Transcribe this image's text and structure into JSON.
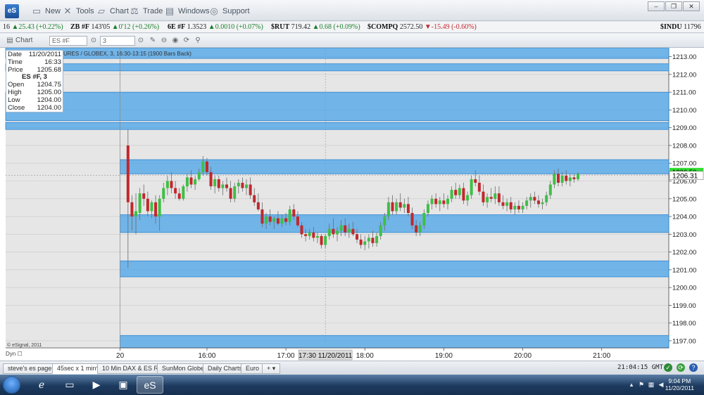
{
  "app": {
    "logo": "eS",
    "menu": [
      {
        "label": "New",
        "icon": "document-icon"
      },
      {
        "label": "Tools",
        "icon": "tools-icon"
      },
      {
        "label": "Chart",
        "icon": "chart-icon"
      },
      {
        "label": "Trade",
        "icon": "trade-icon"
      },
      {
        "label": "Windows",
        "icon": "windows-icon"
      },
      {
        "label": "Support",
        "icon": "support-icon"
      }
    ]
  },
  "ticker": [
    {
      "symbol": "16",
      "last": "",
      "change": "25.43 (+0.22%)",
      "dir": "up"
    },
    {
      "symbol": "ZB #F",
      "last": "143'05",
      "change": "0'12 (+0.26%)",
      "dir": "up"
    },
    {
      "symbol": "6E #F",
      "last": "1.3523",
      "change": "0.0010 (+0.07%)",
      "dir": "up"
    },
    {
      "symbol": "$RUT",
      "last": "719.42",
      "change": "0.68 (+0.09%)",
      "dir": "up"
    },
    {
      "symbol": "$COMPQ",
      "last": "2572.50",
      "change": "-15.49 (-0.60%)",
      "dir": "down"
    },
    {
      "symbol": "$INDU",
      "last": "11796",
      "change": "",
      "dir": "up"
    }
  ],
  "chart_window": {
    "title": "Chart",
    "symbol_value": "ES #F",
    "interval_value": "3",
    "info": "URES / GLOBEX, 3, 16:30-13:15 (1900 Bars Back)",
    "copyright": "© eSignal, 2011",
    "dyn_label": "Dyn"
  },
  "data_window": {
    "date_label": "Date",
    "date": "11/20/2011",
    "time_label": "Time",
    "time": "16:33",
    "price_label": "Price",
    "price": "1205.68",
    "header": "ES #F, 3",
    "open_label": "Open",
    "open": "1204.75",
    "high_label": "High",
    "high": "1205.00",
    "low_label": "Low",
    "low": "1204.00",
    "close_label": "Close",
    "close": "1204.00"
  },
  "chart_data": {
    "type": "candlestick",
    "title": "",
    "y_ticks": [
      1197,
      1198,
      1199,
      1200,
      1201,
      1202,
      1203,
      1204,
      1205,
      1206,
      1207,
      1208,
      1209,
      1210,
      1211,
      1212,
      1213
    ],
    "y_tick_labels": [
      "1197.00",
      "1198.00",
      "1199.00",
      "1200.00",
      "1201.00",
      "1202.00",
      "1203.00",
      "1204.00",
      "1205.00",
      "1206.00",
      "1207.00",
      "1208.00",
      "1209.00",
      "1210.00",
      "1211.00",
      "1212.00",
      "1213.00"
    ],
    "ylim": [
      1196.6,
      1213.5
    ],
    "x_labels": [
      "20",
      "16:00",
      "17:00",
      "18:00",
      "19:00",
      "20:00",
      "21:00"
    ],
    "x_label_times": [
      14.9,
      16.0,
      17.0,
      18.0,
      19.0,
      20.0,
      21.0
    ],
    "xlim": [
      13.45,
      21.85
    ],
    "crosshair_time_label": "17:30 11/20/2011",
    "crosshair_time": 17.5,
    "crosshair_price": 1206.31,
    "price_label": "1206.31",
    "last_price_label": "1206.50",
    "last_price": 1206.5,
    "zones": [
      {
        "low": 1212.9,
        "high": 1213.5,
        "from": 13.45
      },
      {
        "low": 1212.2,
        "high": 1212.6,
        "from": 13.45
      },
      {
        "low": 1209.4,
        "high": 1211.0,
        "from": 13.45
      },
      {
        "low": 1208.9,
        "high": 1209.3,
        "from": 13.45
      },
      {
        "low": 1206.4,
        "high": 1207.2,
        "from": 14.9
      },
      {
        "low": 1203.1,
        "high": 1204.1,
        "from": 14.9
      },
      {
        "low": 1200.6,
        "high": 1201.5,
        "from": 14.9
      },
      {
        "low": 1196.6,
        "high": 1197.3,
        "from": 14.9
      }
    ],
    "candles": [
      {
        "t": 15.0,
        "o": 1208.0,
        "h": 1208.9,
        "l": 1201.1,
        "c": 1204.8
      },
      {
        "t": 15.05,
        "o": 1204.8,
        "h": 1205.2,
        "l": 1203.2,
        "c": 1204.0
      },
      {
        "t": 15.1,
        "o": 1204.0,
        "h": 1205.3,
        "l": 1203.0,
        "c": 1204.3
      },
      {
        "t": 15.15,
        "o": 1204.2,
        "h": 1205.6,
        "l": 1203.8,
        "c": 1205.3
      },
      {
        "t": 15.2,
        "o": 1205.3,
        "h": 1205.8,
        "l": 1204.6,
        "c": 1205.0
      },
      {
        "t": 15.25,
        "o": 1205.0,
        "h": 1205.4,
        "l": 1204.0,
        "c": 1204.3
      },
      {
        "t": 15.3,
        "o": 1204.3,
        "h": 1204.9,
        "l": 1203.9,
        "c": 1204.8
      },
      {
        "t": 15.35,
        "o": 1204.8,
        "h": 1205.2,
        "l": 1203.6,
        "c": 1204.0
      },
      {
        "t": 15.4,
        "o": 1204.0,
        "h": 1205.2,
        "l": 1203.2,
        "c": 1205.0
      },
      {
        "t": 15.45,
        "o": 1205.0,
        "h": 1205.9,
        "l": 1204.8,
        "c": 1205.6
      },
      {
        "t": 15.5,
        "o": 1205.6,
        "h": 1206.3,
        "l": 1205.2,
        "c": 1206.0
      },
      {
        "t": 15.55,
        "o": 1206.0,
        "h": 1206.5,
        "l": 1205.3,
        "c": 1205.6
      },
      {
        "t": 15.6,
        "o": 1205.6,
        "h": 1206.0,
        "l": 1205.0,
        "c": 1205.3
      },
      {
        "t": 15.65,
        "o": 1205.3,
        "h": 1205.6,
        "l": 1204.9,
        "c": 1205.0
      },
      {
        "t": 15.7,
        "o": 1205.0,
        "h": 1205.8,
        "l": 1204.9,
        "c": 1205.7
      },
      {
        "t": 15.75,
        "o": 1205.7,
        "h": 1206.4,
        "l": 1205.4,
        "c": 1206.2
      },
      {
        "t": 15.8,
        "o": 1206.2,
        "h": 1206.6,
        "l": 1205.6,
        "c": 1205.8
      },
      {
        "t": 15.85,
        "o": 1205.8,
        "h": 1206.3,
        "l": 1205.5,
        "c": 1206.1
      },
      {
        "t": 15.9,
        "o": 1206.1,
        "h": 1206.7,
        "l": 1206.0,
        "c": 1206.5
      },
      {
        "t": 15.95,
        "o": 1206.5,
        "h": 1207.4,
        "l": 1206.3,
        "c": 1207.1
      },
      {
        "t": 16.0,
        "o": 1207.1,
        "h": 1207.3,
        "l": 1206.3,
        "c": 1206.5
      },
      {
        "t": 16.05,
        "o": 1206.5,
        "h": 1206.8,
        "l": 1205.5,
        "c": 1205.7
      },
      {
        "t": 16.1,
        "o": 1205.7,
        "h": 1206.3,
        "l": 1205.3,
        "c": 1206.1
      },
      {
        "t": 16.15,
        "o": 1206.1,
        "h": 1206.3,
        "l": 1205.4,
        "c": 1205.6
      },
      {
        "t": 16.2,
        "o": 1205.6,
        "h": 1206.0,
        "l": 1205.2,
        "c": 1205.8
      },
      {
        "t": 16.25,
        "o": 1205.8,
        "h": 1206.2,
        "l": 1205.4,
        "c": 1205.6
      },
      {
        "t": 16.3,
        "o": 1205.6,
        "h": 1206.0,
        "l": 1204.8,
        "c": 1205.0
      },
      {
        "t": 16.35,
        "o": 1205.0,
        "h": 1205.9,
        "l": 1204.8,
        "c": 1205.7
      },
      {
        "t": 16.4,
        "o": 1205.7,
        "h": 1206.1,
        "l": 1205.3,
        "c": 1205.9
      },
      {
        "t": 16.45,
        "o": 1205.9,
        "h": 1206.2,
        "l": 1205.4,
        "c": 1205.6
      },
      {
        "t": 16.5,
        "o": 1205.6,
        "h": 1206.1,
        "l": 1205.2,
        "c": 1205.8
      },
      {
        "t": 16.55,
        "o": 1205.8,
        "h": 1206.2,
        "l": 1205.0,
        "c": 1205.2
      },
      {
        "t": 16.6,
        "o": 1205.2,
        "h": 1205.6,
        "l": 1204.6,
        "c": 1204.8
      },
      {
        "t": 16.65,
        "o": 1204.8,
        "h": 1205.3,
        "l": 1204.3,
        "c": 1204.4
      },
      {
        "t": 16.7,
        "o": 1204.4,
        "h": 1204.8,
        "l": 1203.4,
        "c": 1203.6
      },
      {
        "t": 16.75,
        "o": 1203.6,
        "h": 1204.2,
        "l": 1203.3,
        "c": 1204.0
      },
      {
        "t": 16.8,
        "o": 1204.0,
        "h": 1204.4,
        "l": 1203.5,
        "c": 1203.7
      },
      {
        "t": 16.85,
        "o": 1203.7,
        "h": 1204.0,
        "l": 1203.3,
        "c": 1203.9
      },
      {
        "t": 16.9,
        "o": 1203.9,
        "h": 1204.3,
        "l": 1203.5,
        "c": 1203.6
      },
      {
        "t": 16.95,
        "o": 1203.6,
        "h": 1204.1,
        "l": 1203.4,
        "c": 1203.9
      },
      {
        "t": 17.0,
        "o": 1203.9,
        "h": 1204.2,
        "l": 1203.5,
        "c": 1203.7
      },
      {
        "t": 17.05,
        "o": 1203.7,
        "h": 1204.6,
        "l": 1203.5,
        "c": 1204.4
      },
      {
        "t": 17.1,
        "o": 1204.4,
        "h": 1204.7,
        "l": 1203.8,
        "c": 1204.0
      },
      {
        "t": 17.15,
        "o": 1204.0,
        "h": 1204.3,
        "l": 1203.4,
        "c": 1203.5
      },
      {
        "t": 17.2,
        "o": 1203.5,
        "h": 1203.7,
        "l": 1202.8,
        "c": 1203.0
      },
      {
        "t": 17.25,
        "o": 1203.0,
        "h": 1203.3,
        "l": 1202.6,
        "c": 1202.9
      },
      {
        "t": 17.3,
        "o": 1202.9,
        "h": 1203.3,
        "l": 1202.7,
        "c": 1203.1
      },
      {
        "t": 17.35,
        "o": 1203.1,
        "h": 1203.4,
        "l": 1202.6,
        "c": 1202.8
      },
      {
        "t": 17.4,
        "o": 1202.8,
        "h": 1203.1,
        "l": 1202.5,
        "c": 1202.9
      },
      {
        "t": 17.45,
        "o": 1202.9,
        "h": 1203.0,
        "l": 1202.2,
        "c": 1202.4
      },
      {
        "t": 17.5,
        "o": 1202.4,
        "h": 1203.0,
        "l": 1202.2,
        "c": 1202.9
      },
      {
        "t": 17.55,
        "o": 1202.9,
        "h": 1203.6,
        "l": 1202.7,
        "c": 1203.3
      },
      {
        "t": 17.6,
        "o": 1203.3,
        "h": 1203.9,
        "l": 1202.8,
        "c": 1203.0
      },
      {
        "t": 17.65,
        "o": 1203.0,
        "h": 1203.4,
        "l": 1202.6,
        "c": 1203.2
      },
      {
        "t": 17.7,
        "o": 1203.2,
        "h": 1203.8,
        "l": 1202.9,
        "c": 1203.5
      },
      {
        "t": 17.75,
        "o": 1203.5,
        "h": 1203.9,
        "l": 1202.9,
        "c": 1203.1
      },
      {
        "t": 17.8,
        "o": 1203.1,
        "h": 1203.6,
        "l": 1202.8,
        "c": 1203.3
      },
      {
        "t": 17.85,
        "o": 1203.3,
        "h": 1203.7,
        "l": 1202.9,
        "c": 1203.0
      },
      {
        "t": 17.9,
        "o": 1203.0,
        "h": 1203.3,
        "l": 1202.5,
        "c": 1202.7
      },
      {
        "t": 17.95,
        "o": 1202.7,
        "h": 1203.0,
        "l": 1202.2,
        "c": 1202.4
      },
      {
        "t": 18.0,
        "o": 1202.4,
        "h": 1202.9,
        "l": 1202.1,
        "c": 1202.6
      },
      {
        "t": 18.05,
        "o": 1202.6,
        "h": 1203.0,
        "l": 1202.2,
        "c": 1202.8
      },
      {
        "t": 18.1,
        "o": 1202.8,
        "h": 1203.2,
        "l": 1202.3,
        "c": 1202.5
      },
      {
        "t": 18.15,
        "o": 1202.5,
        "h": 1203.1,
        "l": 1202.3,
        "c": 1202.9
      },
      {
        "t": 18.2,
        "o": 1202.9,
        "h": 1203.7,
        "l": 1202.7,
        "c": 1203.5
      },
      {
        "t": 18.25,
        "o": 1203.5,
        "h": 1204.2,
        "l": 1203.2,
        "c": 1204.0
      },
      {
        "t": 18.3,
        "o": 1204.0,
        "h": 1205.1,
        "l": 1203.8,
        "c": 1204.8
      },
      {
        "t": 18.35,
        "o": 1204.8,
        "h": 1205.2,
        "l": 1204.1,
        "c": 1204.3
      },
      {
        "t": 18.4,
        "o": 1204.3,
        "h": 1205.0,
        "l": 1204.1,
        "c": 1204.8
      },
      {
        "t": 18.45,
        "o": 1204.8,
        "h": 1205.3,
        "l": 1204.3,
        "c": 1204.5
      },
      {
        "t": 18.5,
        "o": 1204.5,
        "h": 1205.0,
        "l": 1204.2,
        "c": 1204.7
      },
      {
        "t": 18.55,
        "o": 1204.7,
        "h": 1205.1,
        "l": 1204.0,
        "c": 1204.2
      },
      {
        "t": 18.6,
        "o": 1204.2,
        "h": 1204.5,
        "l": 1203.3,
        "c": 1203.5
      },
      {
        "t": 18.65,
        "o": 1203.5,
        "h": 1203.8,
        "l": 1202.9,
        "c": 1203.1
      },
      {
        "t": 18.7,
        "o": 1203.1,
        "h": 1203.7,
        "l": 1202.9,
        "c": 1203.5
      },
      {
        "t": 18.75,
        "o": 1203.5,
        "h": 1204.4,
        "l": 1203.3,
        "c": 1204.2
      },
      {
        "t": 18.8,
        "o": 1204.2,
        "h": 1204.9,
        "l": 1204.0,
        "c": 1204.7
      },
      {
        "t": 18.85,
        "o": 1204.7,
        "h": 1205.2,
        "l": 1204.4,
        "c": 1205.0
      },
      {
        "t": 18.9,
        "o": 1205.0,
        "h": 1205.3,
        "l": 1204.5,
        "c": 1204.7
      },
      {
        "t": 18.95,
        "o": 1204.7,
        "h": 1205.1,
        "l": 1204.3,
        "c": 1204.9
      },
      {
        "t": 19.0,
        "o": 1204.9,
        "h": 1205.3,
        "l": 1204.5,
        "c": 1204.7
      },
      {
        "t": 19.05,
        "o": 1204.7,
        "h": 1205.2,
        "l": 1204.4,
        "c": 1205.0
      },
      {
        "t": 19.1,
        "o": 1205.0,
        "h": 1205.7,
        "l": 1204.8,
        "c": 1205.5
      },
      {
        "t": 19.15,
        "o": 1205.5,
        "h": 1205.9,
        "l": 1205.0,
        "c": 1205.2
      },
      {
        "t": 19.2,
        "o": 1205.2,
        "h": 1205.8,
        "l": 1205.0,
        "c": 1205.6
      },
      {
        "t": 19.25,
        "o": 1205.6,
        "h": 1205.9,
        "l": 1204.7,
        "c": 1204.9
      },
      {
        "t": 19.3,
        "o": 1204.9,
        "h": 1205.4,
        "l": 1204.6,
        "c": 1205.2
      },
      {
        "t": 19.35,
        "o": 1205.2,
        "h": 1206.3,
        "l": 1205.0,
        "c": 1206.1
      },
      {
        "t": 19.4,
        "o": 1206.1,
        "h": 1206.6,
        "l": 1205.7,
        "c": 1205.9
      },
      {
        "t": 19.45,
        "o": 1205.9,
        "h": 1206.3,
        "l": 1205.2,
        "c": 1205.4
      },
      {
        "t": 19.5,
        "o": 1205.4,
        "h": 1205.8,
        "l": 1204.6,
        "c": 1204.8
      },
      {
        "t": 19.55,
        "o": 1204.8,
        "h": 1205.3,
        "l": 1204.5,
        "c": 1205.1
      },
      {
        "t": 19.6,
        "o": 1205.1,
        "h": 1205.6,
        "l": 1204.8,
        "c": 1205.0
      },
      {
        "t": 19.65,
        "o": 1205.0,
        "h": 1205.7,
        "l": 1204.7,
        "c": 1205.3
      },
      {
        "t": 19.7,
        "o": 1205.3,
        "h": 1205.7,
        "l": 1204.6,
        "c": 1204.8
      },
      {
        "t": 19.75,
        "o": 1204.8,
        "h": 1205.2,
        "l": 1204.4,
        "c": 1204.6
      },
      {
        "t": 19.8,
        "o": 1204.6,
        "h": 1205.0,
        "l": 1204.3,
        "c": 1204.8
      },
      {
        "t": 19.85,
        "o": 1204.8,
        "h": 1205.1,
        "l": 1204.2,
        "c": 1204.4
      },
      {
        "t": 19.9,
        "o": 1204.4,
        "h": 1204.8,
        "l": 1204.1,
        "c": 1204.6
      },
      {
        "t": 19.95,
        "o": 1204.6,
        "h": 1204.9,
        "l": 1204.2,
        "c": 1204.4
      },
      {
        "t": 20.0,
        "o": 1204.4,
        "h": 1204.8,
        "l": 1204.2,
        "c": 1204.6
      },
      {
        "t": 20.05,
        "o": 1204.6,
        "h": 1205.1,
        "l": 1204.4,
        "c": 1204.9
      },
      {
        "t": 20.1,
        "o": 1204.9,
        "h": 1205.3,
        "l": 1204.5,
        "c": 1205.1
      },
      {
        "t": 20.15,
        "o": 1205.1,
        "h": 1205.4,
        "l": 1204.7,
        "c": 1204.9
      },
      {
        "t": 20.2,
        "o": 1204.9,
        "h": 1205.2,
        "l": 1204.5,
        "c": 1204.7
      },
      {
        "t": 20.25,
        "o": 1204.7,
        "h": 1205.0,
        "l": 1204.4,
        "c": 1204.8
      },
      {
        "t": 20.3,
        "o": 1204.8,
        "h": 1205.4,
        "l": 1204.6,
        "c": 1205.2
      },
      {
        "t": 20.35,
        "o": 1205.2,
        "h": 1206.0,
        "l": 1205.0,
        "c": 1205.8
      },
      {
        "t": 20.4,
        "o": 1205.8,
        "h": 1206.6,
        "l": 1205.6,
        "c": 1206.4
      },
      {
        "t": 20.45,
        "o": 1206.4,
        "h": 1206.7,
        "l": 1205.7,
        "c": 1205.9
      },
      {
        "t": 20.5,
        "o": 1205.9,
        "h": 1206.5,
        "l": 1205.7,
        "c": 1206.3
      },
      {
        "t": 20.55,
        "o": 1206.3,
        "h": 1206.6,
        "l": 1205.8,
        "c": 1206.0
      },
      {
        "t": 20.6,
        "o": 1206.0,
        "h": 1206.4,
        "l": 1205.7,
        "c": 1206.2
      },
      {
        "t": 20.65,
        "o": 1206.2,
        "h": 1206.4,
        "l": 1205.9,
        "c": 1206.1
      },
      {
        "t": 20.7,
        "o": 1206.1,
        "h": 1206.5,
        "l": 1206.0,
        "c": 1206.4
      }
    ]
  },
  "tabs": [
    {
      "label": "steve's es page",
      "active": false
    },
    {
      "label": "45sec x 1 min*",
      "active": true
    },
    {
      "label": "10 Min DAX & ES RTH",
      "active": false
    },
    {
      "label": "SunMon Globex",
      "active": false
    },
    {
      "label": "Daily Charts",
      "active": false
    },
    {
      "label": "Euro",
      "active": false
    }
  ],
  "tab_add": "+",
  "status": {
    "time": "21:04:15 GMT-8"
  },
  "taskbar": {
    "clock_time": "9:04 PM",
    "clock_date": "11/20/2011",
    "apps": [
      "ie-icon",
      "folder-icon",
      "media-icon",
      "network-icon",
      "esignal-icon"
    ]
  },
  "colors": {
    "zone_fill": "#4aa3e8",
    "up_candle": "#3fbf45",
    "down_candle": "#c0282d",
    "last_price_bg": "#33dd33"
  }
}
